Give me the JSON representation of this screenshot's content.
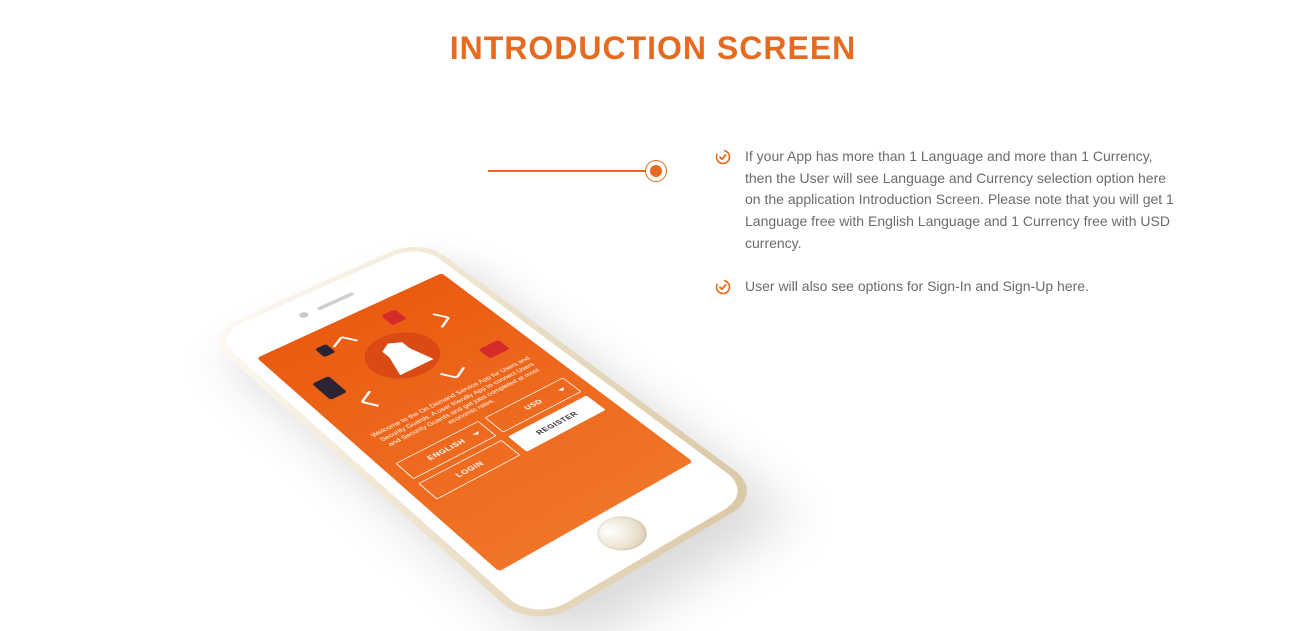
{
  "title": "INTRODUCTION SCREEN",
  "phone": {
    "welcome_text": "Welcome to the On Demand Service App for Users and Security Guards. A user friendly App to connect Users and Security Guards and get jobs completed at most economic rates.",
    "language_select": "ENGLISH",
    "currency_select": "USD",
    "login_label": "LOGIN",
    "register_label": "REGISTER"
  },
  "bullets": [
    "If your App has more than 1 Language and more than 1 Currency, then the User will see Language and Currency selection option here on the application Introduction Screen. Please note that you will get 1 Language free with English Language and 1 Currency free with USD currency.",
    "User will also see options for Sign-In and Sign-Up here."
  ],
  "colors": {
    "accent": "#e66a1f"
  }
}
